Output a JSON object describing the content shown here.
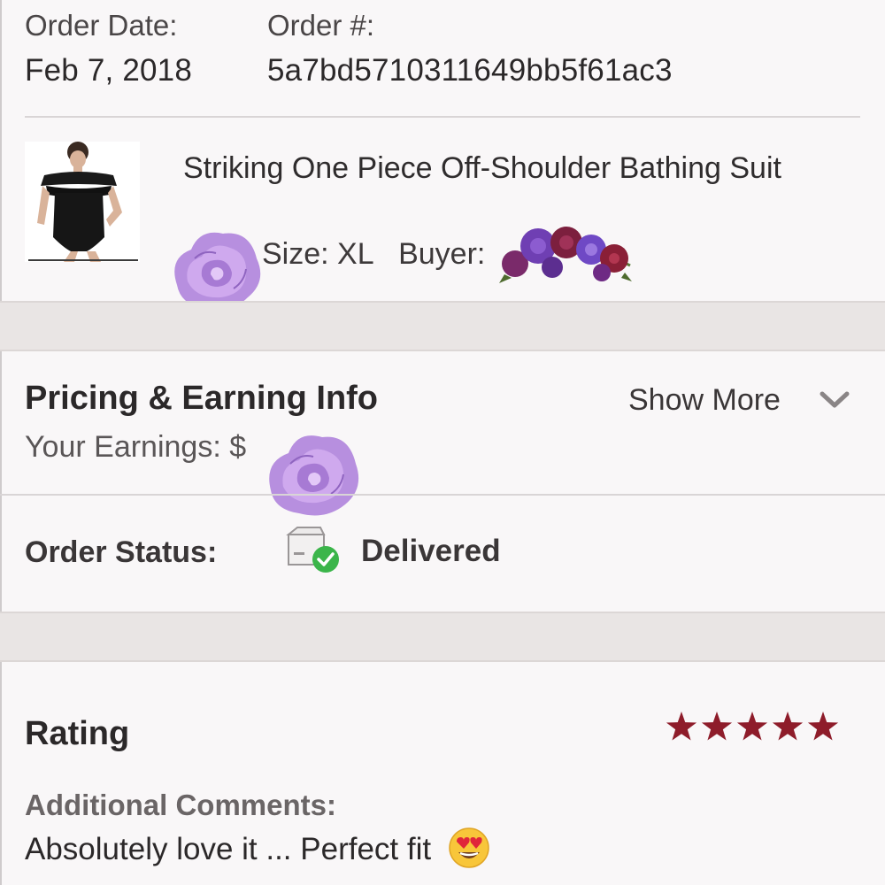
{
  "order": {
    "date_label": "Order Date:",
    "date_value": "Feb 7, 2018",
    "number_label": "Order #:",
    "number_value": "5a7bd5710311649bb5f61ac3"
  },
  "item": {
    "title": "Striking One Piece Off-Shoulder Bathing Suit",
    "size": "Size: XL",
    "buyer_label": "Buyer:"
  },
  "pricing": {
    "title": "Pricing & Earning Info",
    "show_more": "Show More",
    "earnings_label": "Your Earnings: $"
  },
  "status": {
    "label": "Order Status:",
    "value": "Delivered"
  },
  "rating": {
    "title": "Rating",
    "stars": 5,
    "star_color": "#8e1c2a",
    "comments_label": "Additional Comments:",
    "comment_text": "Absolutely love it ... Perfect fit"
  },
  "icons": {
    "status_icon": "package-delivered-icon",
    "expand_icon": "chevron-down-icon",
    "emoji": "heart-eyes-emoji",
    "stickers": "purple-rose-sticker"
  },
  "colors": {
    "background": "#f9f7f8",
    "band": "#e9e5e4",
    "delivered_check": "#3bb54a"
  }
}
